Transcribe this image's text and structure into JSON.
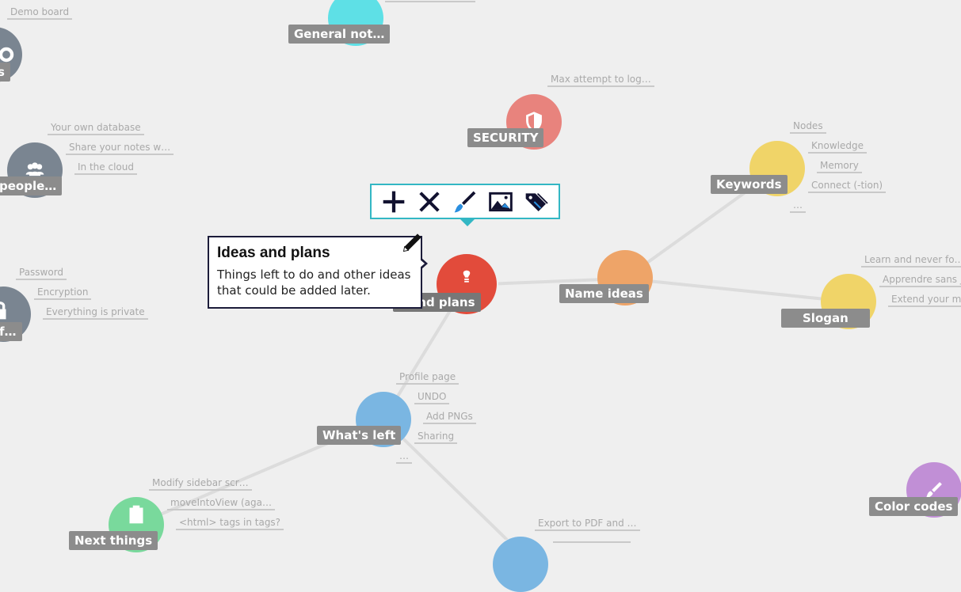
{
  "colors": {
    "background": "#efefef",
    "toolbar_border": "#33b7c4",
    "card_border": "#1c1c3a",
    "label_bg": "#8c8c8c",
    "tag_text": "#a9a9a9",
    "edge": "#dcdcdc"
  },
  "nodes": {
    "demo_board": {
      "label": "s",
      "color": "#7a8591",
      "icon": "gear-icon"
    },
    "general_notes": {
      "label": "General not…",
      "color": "#5ee0e6"
    },
    "security": {
      "label": "SECURITY",
      "color": "#e8837d",
      "icon": "shield-icon"
    },
    "people": {
      "label": "people…",
      "color": "#7a8591",
      "icon": "users-icon"
    },
    "keywords": {
      "label": "Keywords",
      "color": "#f0d468"
    },
    "ideas_plans": {
      "label": "s and plans",
      "color": "#e24b3b",
      "icon": "lightbulb-icon"
    },
    "name_ideas": {
      "label": "Name ideas",
      "color": "#eea468"
    },
    "slogan": {
      "label": "Slogan",
      "color": "#f0d468"
    },
    "privacy": {
      "label": "f…",
      "color": "#7a8591",
      "icon": "lock-icon"
    },
    "whats_left": {
      "label": "What's left",
      "color": "#7ab6e2"
    },
    "next_things": {
      "label": "Next things",
      "color": "#79d99c",
      "icon": "clipboard-icon"
    },
    "color_codes": {
      "label": "Color codes",
      "color": "#c18fd6",
      "icon": "brush-icon"
    },
    "export": {
      "label": "",
      "color": "#7ab6e2"
    }
  },
  "tags": {
    "demo_board": "Demo board",
    "general_top": "",
    "security": "Max attempt to log…",
    "people": [
      "Your own database",
      "Share your notes w…",
      "In the cloud"
    ],
    "keywords": [
      "Nodes",
      "Knowledge",
      "Memory",
      "Connect (-tion)",
      "…"
    ],
    "slogan": [
      "Learn and never fo…",
      "Apprendre sans ja…",
      "Extend your men"
    ],
    "privacy": [
      "Password",
      "Encryption",
      "Everything is private"
    ],
    "whats_left": [
      "Profile page",
      "UNDO",
      "Add PNGs",
      "Sharing",
      "…"
    ],
    "next_things": [
      "Modify sidebar scr…",
      "moveIntoView (aga…",
      "<html> tags in tags?"
    ],
    "export": [
      "Export to PDF and …",
      ""
    ]
  },
  "toolbar": {
    "tools": [
      "plus-icon",
      "close-icon",
      "brush-icon",
      "image-icon",
      "tag-icon"
    ]
  },
  "card": {
    "title": "Ideas and plans",
    "description": "Things left to do and other ideas that could be added later."
  }
}
